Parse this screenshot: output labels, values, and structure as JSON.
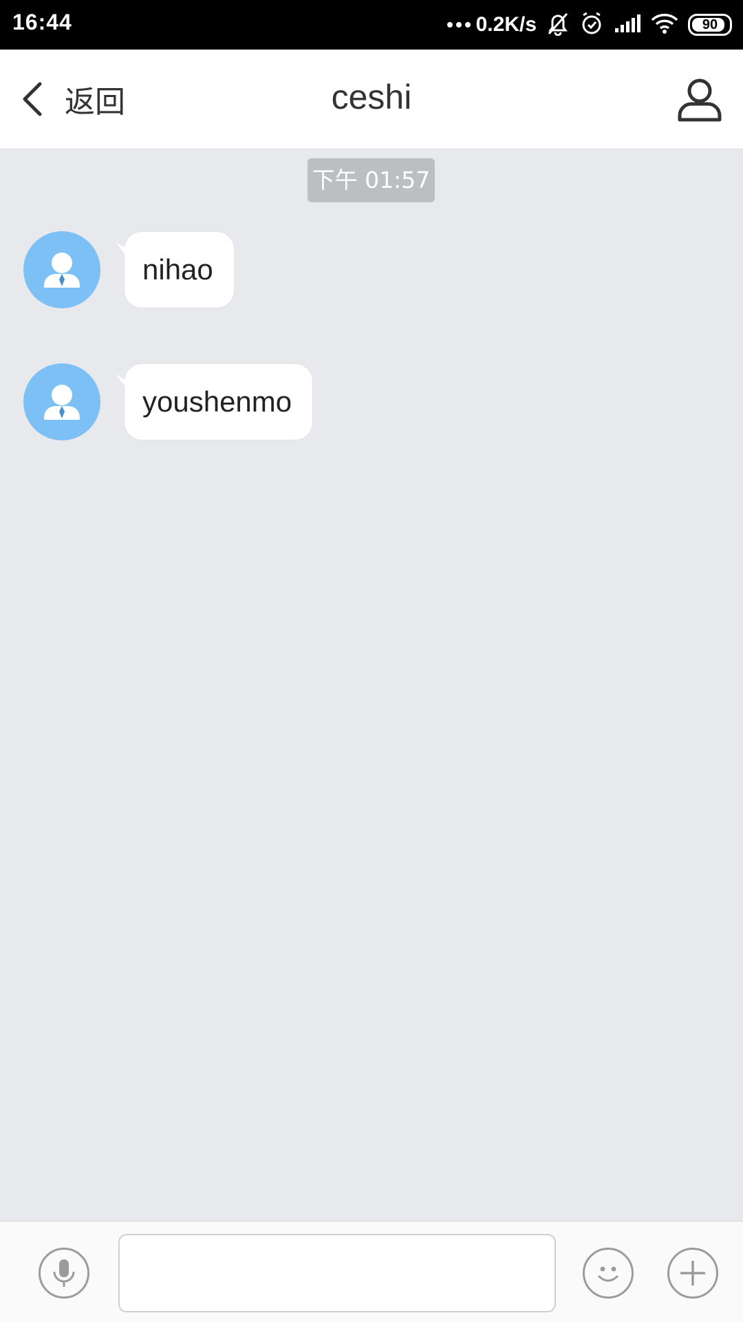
{
  "status_bar": {
    "time": "16:44",
    "net_speed": "0.2K/s",
    "battery": "90",
    "battery_level": 0.9,
    "icons": [
      "more-dots-icon",
      "mute-bell-icon",
      "alarm-icon",
      "signal-icon",
      "wifi-icon",
      "battery-icon"
    ]
  },
  "header": {
    "back_label": "返回",
    "title": "ceshi",
    "back_icon": "chevron-left-icon",
    "profile_icon": "user-profile-icon"
  },
  "chat": {
    "timestamp": "下午 01:57",
    "messages": [
      {
        "sender": "other",
        "text": "nihao"
      },
      {
        "sender": "other",
        "text": "youshenmo"
      }
    ]
  },
  "input_bar": {
    "message_value": "",
    "icons": [
      "microphone-icon",
      "emoji-icon",
      "plus-icon"
    ]
  },
  "colors": {
    "status_bar_bg": "#000000",
    "header_bg": "#ffffff",
    "chat_bg": "#e8e9ec",
    "avatar_bg": "#7cc0f6",
    "timestamp_bg": "#bdbec0",
    "bubble_bg": "#ffffff"
  }
}
